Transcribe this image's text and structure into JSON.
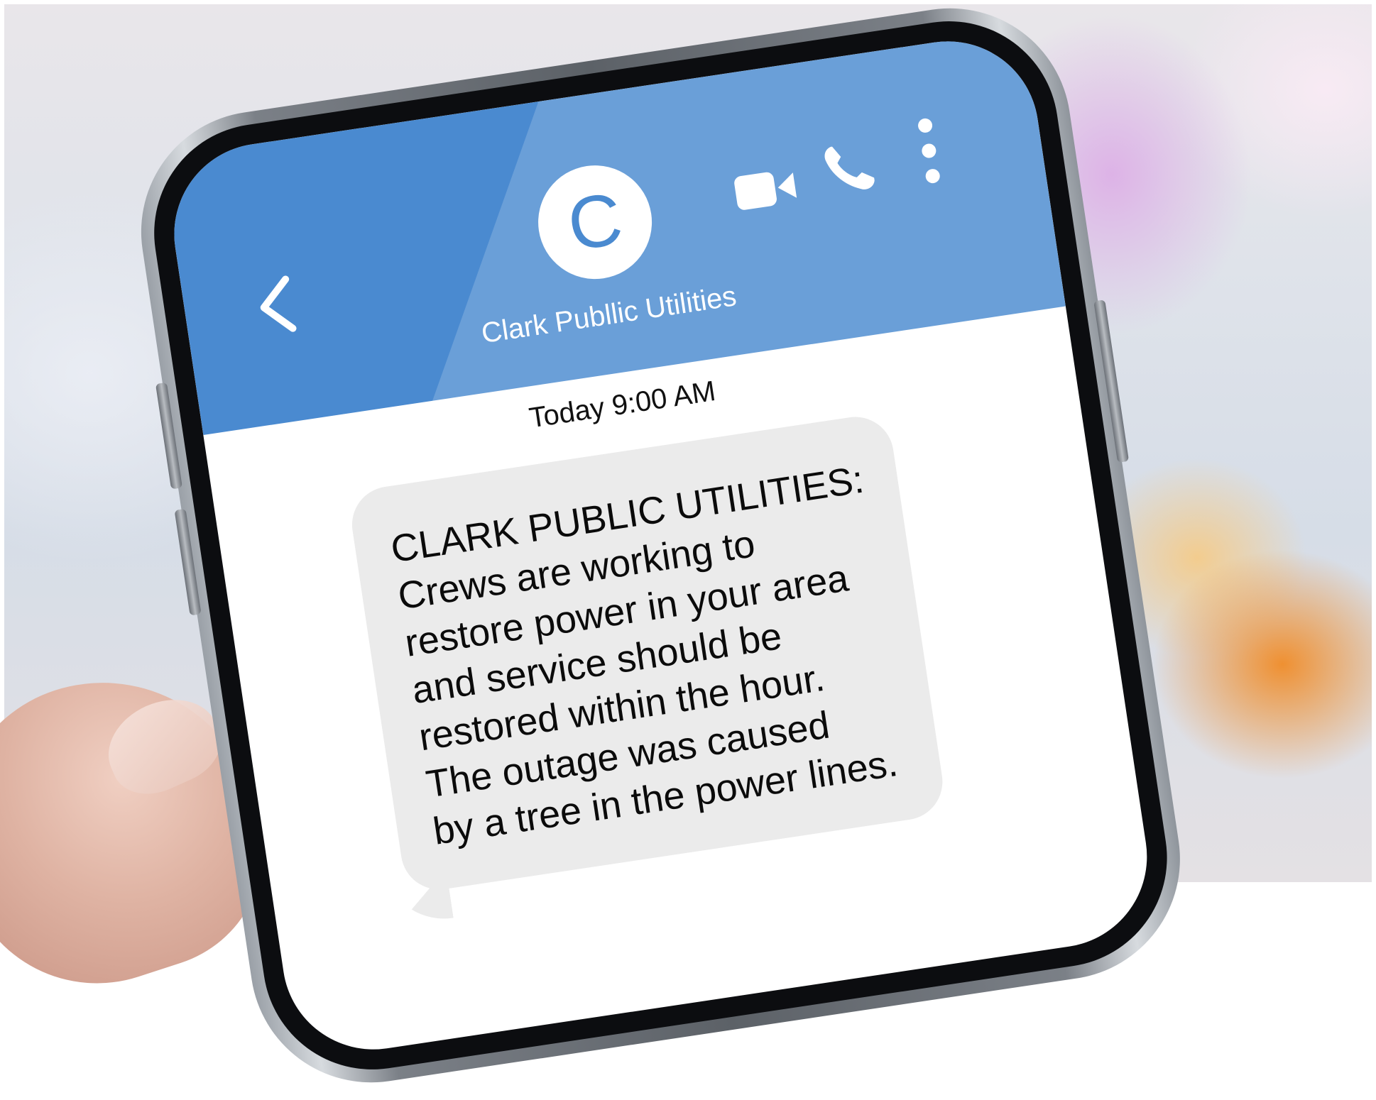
{
  "conversation": {
    "contact_name": "Clark Publlic Utilities",
    "avatar_initial": "C",
    "timestamp": "Today 9:00 AM"
  },
  "header": {
    "icons": [
      "back-chevron-icon",
      "video-camera-icon",
      "phone-icon",
      "more-vertical-icon"
    ]
  },
  "message": {
    "lines": [
      "CLARK PUBLIC UTILITIES:",
      "Crews are working to",
      "restore power in your area",
      "and service should be",
      "restored within the hour.",
      "The outage was caused",
      "by a tree in the power lines."
    ]
  },
  "colors": {
    "header": "#4a8ad0",
    "bubble": "#ebebeb",
    "background": "#ffffff"
  }
}
